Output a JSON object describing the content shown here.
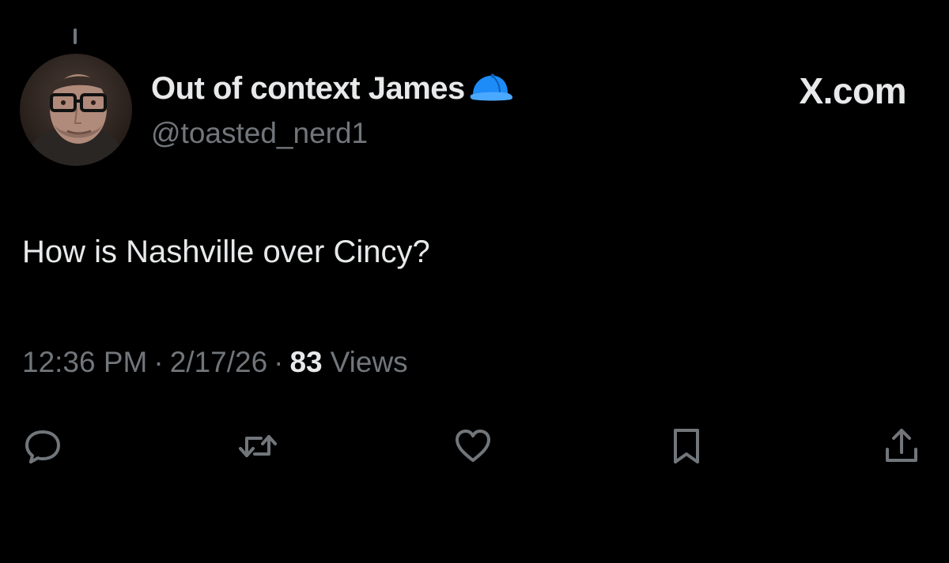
{
  "tweet": {
    "display_name": "Out of context James",
    "handle": "@toasted_nerd1",
    "text": "How is Nashville over Cincy?",
    "time": "12:36 PM",
    "separator": "·",
    "date": "2/17/26",
    "views_count": "83",
    "views_label": "Views"
  },
  "brand": {
    "label": "X.com"
  },
  "icons": {
    "avatar": "avatar-photo",
    "name_badge": "blue-cap-icon",
    "actions": [
      "reply-icon",
      "retweet-icon",
      "like-icon",
      "bookmark-icon",
      "share-icon"
    ]
  },
  "colors": {
    "background": "#000000",
    "primary_text": "#e7e9ea",
    "secondary_text": "#71767b",
    "cap_blue": "#1d8cf8"
  }
}
